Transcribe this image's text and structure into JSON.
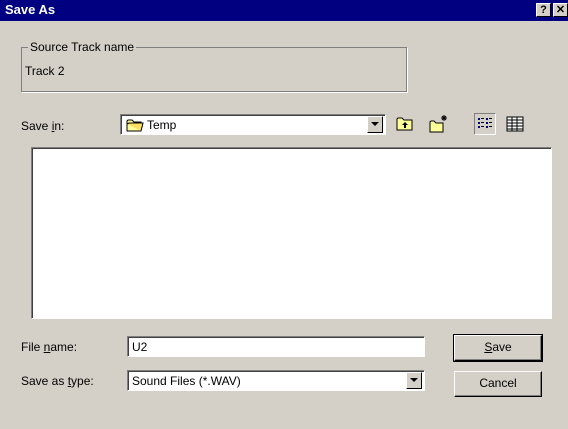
{
  "window": {
    "title": "Save As",
    "help_glyph": "?",
    "close_glyph": "✕"
  },
  "source": {
    "legend": "Source Track name",
    "value": "Track 2"
  },
  "save_in": {
    "label_pre": "Save ",
    "label_u": "i",
    "label_post": "n:",
    "folder_icon": "folder-icon",
    "value": "Temp"
  },
  "toolbar": {
    "icons": [
      "up-one-level-icon",
      "create-new-folder-icon",
      "list-view-icon",
      "details-view-icon"
    ],
    "selected_view": "list"
  },
  "file_list": {
    "items": []
  },
  "file_name": {
    "label_pre": "File ",
    "label_u": "n",
    "label_post": "ame:",
    "value": "U2"
  },
  "save_type": {
    "label_pre": "Save as ",
    "label_u": "t",
    "label_post": "ype:",
    "value": "Sound Files (*.WAV)"
  },
  "buttons": {
    "save_u": "S",
    "save_rest": "ave",
    "cancel": "Cancel"
  },
  "colors": {
    "title_bar": "#000080",
    "face": "#d4d0c8"
  }
}
